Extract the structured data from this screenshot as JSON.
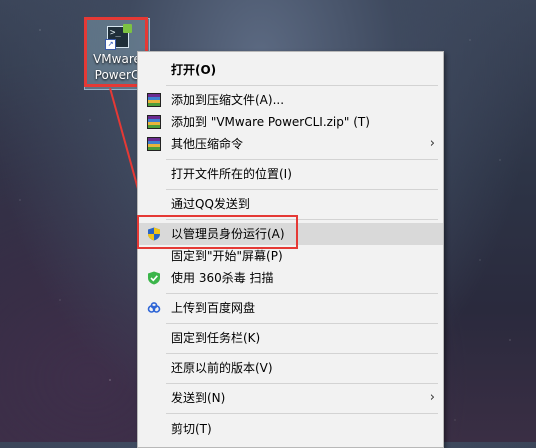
{
  "desktop_icon": {
    "label_line1": "VMware",
    "label_line2": "PowerC"
  },
  "menu": {
    "items": [
      {
        "label": "打开(O)"
      },
      {
        "label": "添加到压缩文件(A)..."
      },
      {
        "label": "添加到 \"VMware PowerCLI.zip\" (T)"
      },
      {
        "label": "其他压缩命令"
      },
      {
        "label": "打开文件所在的位置(I)"
      },
      {
        "label": "通过QQ发送到"
      },
      {
        "label": "以管理员身份运行(A)"
      },
      {
        "label": "固定到\"开始\"屏幕(P)"
      },
      {
        "label": "使用 360杀毒 扫描"
      },
      {
        "label": "上传到百度网盘"
      },
      {
        "label": "固定到任务栏(K)"
      },
      {
        "label": "还原以前的版本(V)"
      },
      {
        "label": "发送到(N)"
      },
      {
        "label": "剪切(T)"
      }
    ]
  },
  "colors": {
    "annotation": "#e53935",
    "hover": "#d9d9d9",
    "menu_bg": "#f2f2f2"
  },
  "icons": [
    "winrar-icon",
    "uac-shield-icon",
    "360-shield-icon",
    "baidu-cloud-icon",
    "submenu-arrow-icon"
  ]
}
